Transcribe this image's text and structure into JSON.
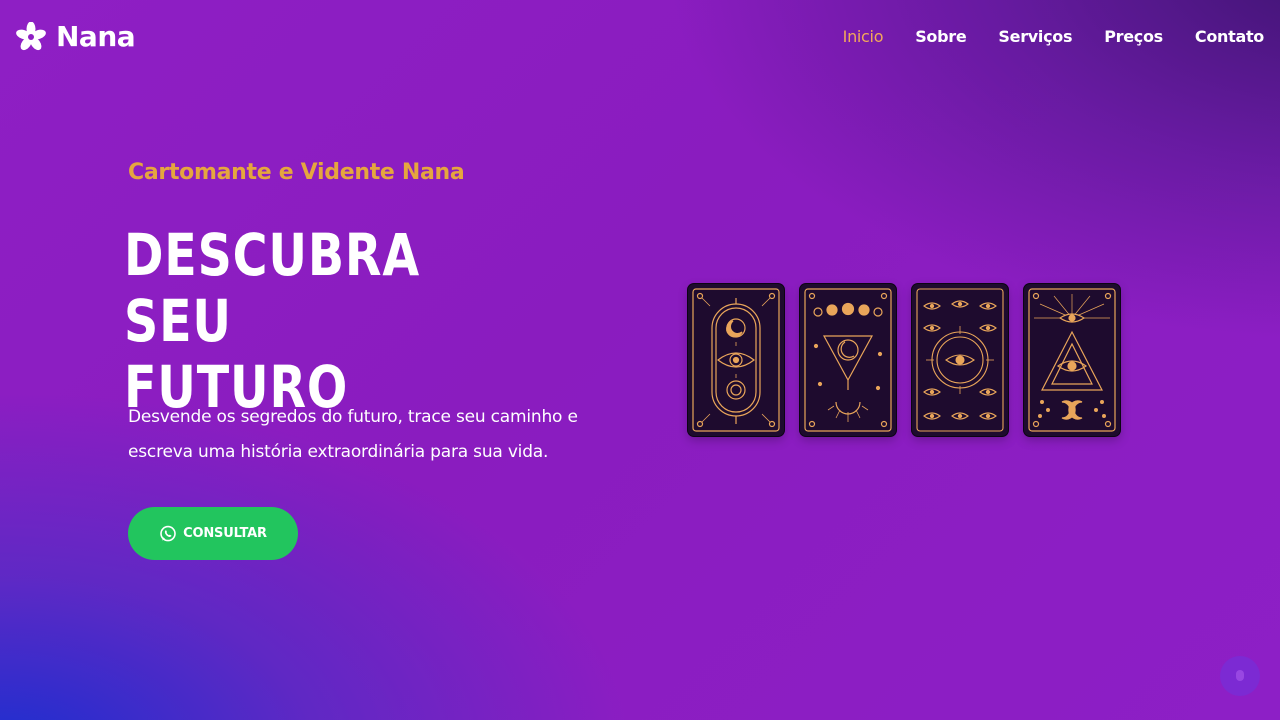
{
  "brand": {
    "name": "Nana",
    "logo_icon": "flower-icon"
  },
  "nav": {
    "items": [
      {
        "label": "Inicio",
        "active": true
      },
      {
        "label": "Sobre",
        "active": false
      },
      {
        "label": "Serviços",
        "active": false
      },
      {
        "label": "Preços",
        "active": false
      },
      {
        "label": "Contato",
        "active": false
      }
    ],
    "active_color": "#f3a85a"
  },
  "hero": {
    "eyebrow": "Cartomante e Vidente Nana",
    "headline_line1": "DESCUBRA SEU",
    "headline_line2": "FUTURO",
    "subtitle_line1": "Desvende os segredos do futuro, trace seu caminho e",
    "subtitle_line2": "escreva uma história extraordinária para sua vida.",
    "cta_label": "CONSULTAR",
    "cta_icon": "whatsapp-icon"
  },
  "colors": {
    "accent_gold": "#e5a63e",
    "cta_green": "#22c55e",
    "background_purple": "#8e1fc4",
    "card_background": "#1e0b2e",
    "card_gold": "#e9a55a"
  },
  "cards": [
    {
      "icon": "tarot-card-moon-eye-icon"
    },
    {
      "icon": "tarot-card-triangle-moon-icon"
    },
    {
      "icon": "tarot-card-many-eyes-icon"
    },
    {
      "icon": "tarot-card-pyramid-eye-icon"
    }
  ],
  "floating_button": {
    "icon": "chat-bubble-icon"
  }
}
